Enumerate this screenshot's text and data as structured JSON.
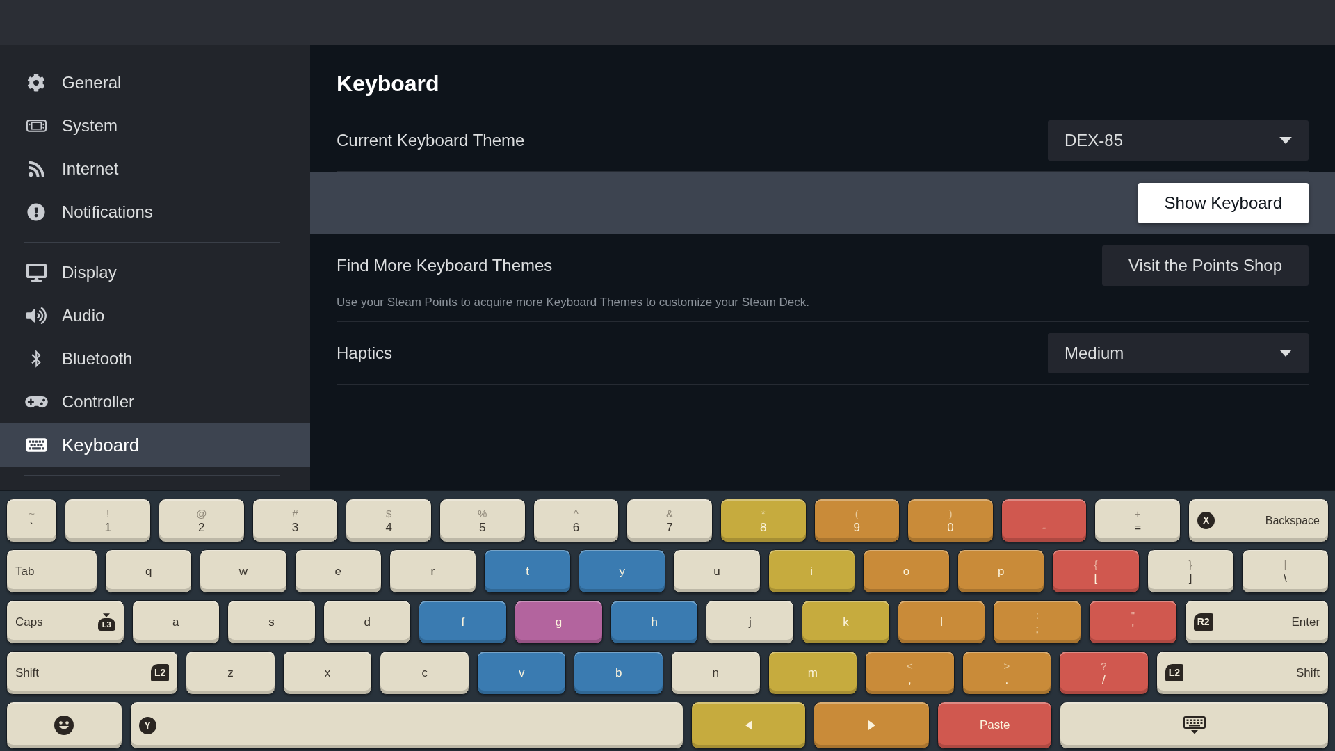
{
  "sidebar": {
    "groups": [
      {
        "items": [
          {
            "label": "General",
            "selected": false
          },
          {
            "label": "System",
            "selected": false
          },
          {
            "label": "Internet",
            "selected": false
          },
          {
            "label": "Notifications",
            "selected": false
          }
        ]
      },
      {
        "items": [
          {
            "label": "Display",
            "selected": false
          },
          {
            "label": "Audio",
            "selected": false
          },
          {
            "label": "Bluetooth",
            "selected": false
          },
          {
            "label": "Controller",
            "selected": false
          },
          {
            "label": "Keyboard",
            "selected": true
          }
        ]
      }
    ]
  },
  "page": {
    "title": "Keyboard",
    "settings": [
      {
        "kind": "dropdown",
        "label": "Current Keyboard Theme",
        "value": "DEX-85",
        "focused": false
      },
      {
        "kind": "button",
        "button": "Show Keyboard",
        "focused": true
      },
      {
        "kind": "button",
        "label": "Find More Keyboard Themes",
        "button": "Visit the Points Shop",
        "description": "Use your Steam Points to acquire more Keyboard Themes to customize your Steam Deck.",
        "focused": false
      },
      {
        "kind": "dropdown",
        "label": "Haptics",
        "value": "Medium",
        "focused": false
      }
    ]
  },
  "keyboard": {
    "rows": [
      {
        "keys": [
          {
            "kind": "narrow",
            "shift": "~",
            "label": "`",
            "color": "#e2dcc8"
          },
          {
            "kind": "symbol",
            "shift": "!",
            "label": "1",
            "color": "#e2dcc8"
          },
          {
            "kind": "symbol",
            "shift": "@",
            "label": "2",
            "color": "#e2dcc8"
          },
          {
            "kind": "symbol",
            "shift": "#",
            "label": "3",
            "color": "#e2dcc8"
          },
          {
            "kind": "symbol",
            "shift": "$",
            "label": "4",
            "color": "#e2dcc8"
          },
          {
            "kind": "symbol",
            "shift": "%",
            "label": "5",
            "color": "#e2dcc8"
          },
          {
            "kind": "symbol",
            "shift": "^",
            "label": "6",
            "color": "#e2dcc8"
          },
          {
            "kind": "symbol",
            "shift": "&",
            "label": "7",
            "color": "#e2dcc8"
          },
          {
            "kind": "symbol",
            "shift": "*",
            "label": "8",
            "color": "#c6ab3e"
          },
          {
            "kind": "symbol",
            "shift": "(",
            "label": "9",
            "color": "#c98b39"
          },
          {
            "kind": "symbol",
            "shift": ")",
            "label": "0",
            "color": "#c98b39"
          },
          {
            "kind": "symbol",
            "shift": "_",
            "label": "-",
            "color": "#d0584f"
          },
          {
            "kind": "symbol",
            "shift": "+",
            "label": "=",
            "color": "#e2dcc8"
          },
          {
            "kind": "backspace",
            "hint": "X",
            "label": "Backspace",
            "color": "#e2dcc8"
          }
        ]
      },
      {
        "keys": [
          {
            "kind": "tab",
            "label": "Tab",
            "color": "#e2dcc8"
          },
          {
            "kind": "letter",
            "label": "q",
            "color": "#e2dcc8"
          },
          {
            "kind": "letter",
            "label": "w",
            "color": "#e2dcc8"
          },
          {
            "kind": "letter",
            "label": "e",
            "color": "#e2dcc8"
          },
          {
            "kind": "letter",
            "label": "r",
            "color": "#e2dcc8"
          },
          {
            "kind": "letter",
            "label": "t",
            "color": "#3a7bb1"
          },
          {
            "kind": "letter",
            "label": "y",
            "color": "#3a7bb1"
          },
          {
            "kind": "letter",
            "label": "u",
            "color": "#e2dcc8"
          },
          {
            "kind": "letter",
            "label": "i",
            "color": "#c6ab3e"
          },
          {
            "kind": "letter",
            "label": "o",
            "color": "#c98b39"
          },
          {
            "kind": "letter",
            "label": "p",
            "color": "#c98b39"
          },
          {
            "kind": "symbol",
            "shift": "{",
            "label": "[",
            "color": "#d0584f"
          },
          {
            "kind": "symbol",
            "shift": "}",
            "label": "]",
            "color": "#e2dcc8"
          },
          {
            "kind": "symbol",
            "shift": "|",
            "label": "\\",
            "color": "#e2dcc8"
          }
        ]
      },
      {
        "keys": [
          {
            "kind": "caps",
            "label": "Caps",
            "hint": "L3",
            "color": "#e2dcc8"
          },
          {
            "kind": "letter",
            "label": "a",
            "color": "#e2dcc8"
          },
          {
            "kind": "letter",
            "label": "s",
            "color": "#e2dcc8"
          },
          {
            "kind": "letter",
            "label": "d",
            "color": "#e2dcc8"
          },
          {
            "kind": "letter",
            "label": "f",
            "color": "#3a7bb1"
          },
          {
            "kind": "letter",
            "label": "g",
            "color": "#b3649e"
          },
          {
            "kind": "letter",
            "label": "h",
            "color": "#3a7bb1"
          },
          {
            "kind": "letter",
            "label": "j",
            "color": "#e2dcc8"
          },
          {
            "kind": "letter",
            "label": "k",
            "color": "#c6ab3e"
          },
          {
            "kind": "letter",
            "label": "l",
            "color": "#c98b39"
          },
          {
            "kind": "symbol",
            "shift": ":",
            "label": ";",
            "color": "#c98b39"
          },
          {
            "kind": "symbol",
            "shift": "\"",
            "label": "'",
            "color": "#d0584f"
          },
          {
            "kind": "enter",
            "hint": "R2",
            "label": "Enter",
            "color": "#e2dcc8"
          }
        ]
      },
      {
        "keys": [
          {
            "kind": "lshift",
            "label": "Shift",
            "hint": "L2",
            "color": "#e2dcc8"
          },
          {
            "kind": "letter",
            "label": "z",
            "color": "#e2dcc8"
          },
          {
            "kind": "letter",
            "label": "x",
            "color": "#e2dcc8"
          },
          {
            "kind": "letter",
            "label": "c",
            "color": "#e2dcc8"
          },
          {
            "kind": "letter",
            "label": "v",
            "color": "#3a7bb1"
          },
          {
            "kind": "letter",
            "label": "b",
            "color": "#3a7bb1"
          },
          {
            "kind": "letter",
            "label": "n",
            "color": "#e2dcc8"
          },
          {
            "kind": "letter",
            "label": "m",
            "color": "#c6ab3e"
          },
          {
            "kind": "symbol",
            "shift": "<",
            "label": ",",
            "color": "#c98b39"
          },
          {
            "kind": "symbol",
            "shift": ">",
            "label": ".",
            "color": "#c98b39"
          },
          {
            "kind": "symbol",
            "shift": "?",
            "label": "/",
            "color": "#d0584f"
          },
          {
            "kind": "rshift",
            "hint": "L2",
            "label": "Shift",
            "color": "#e2dcc8"
          }
        ]
      },
      {
        "keys": [
          {
            "kind": "emoji",
            "color": "#e2dcc8"
          },
          {
            "kind": "space",
            "hint": "Y",
            "color": "#e2dcc8"
          },
          {
            "kind": "left",
            "color": "#c6ab3e"
          },
          {
            "kind": "right",
            "color": "#c98b39"
          },
          {
            "kind": "paste",
            "label": "Paste",
            "color": "#d0584f"
          },
          {
            "kind": "hide",
            "color": "#e2dcc8"
          }
        ]
      }
    ]
  }
}
